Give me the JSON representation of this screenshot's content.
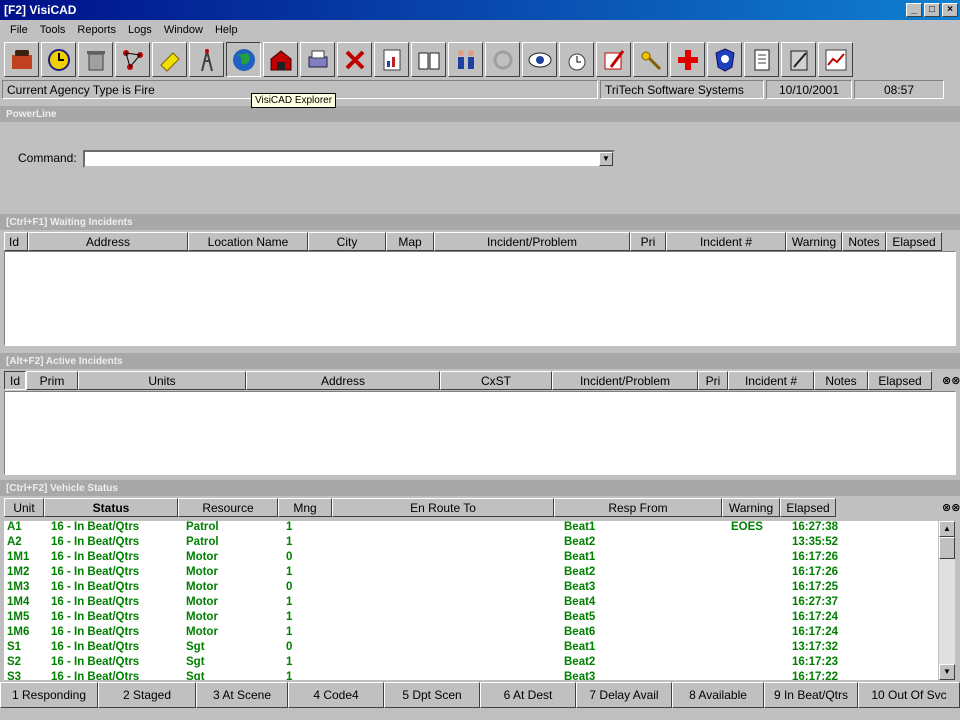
{
  "window": {
    "title": "[F2]   VisiCAD"
  },
  "menu": [
    "File",
    "Tools",
    "Reports",
    "Logs",
    "Window",
    "Help"
  ],
  "toolbar": {
    "icons": [
      "phone-call-icon",
      "clock-icon",
      "trash-can-icon",
      "network-icon",
      "eraser-icon",
      "radio-tower-icon",
      "globe-explorer-icon",
      "fire-station-icon",
      "printer-icon",
      "tools-icon",
      "report-icon",
      "book-icon",
      "people-icon",
      "refresh-icon",
      "eye-icon",
      "alarm-icon",
      "map-pencil-icon",
      "key-icon",
      "red-cross-icon",
      "police-badge-icon",
      "notepad-icon",
      "clipboard-icon",
      "chart-icon"
    ],
    "tooltip": "VisiCAD Explorer"
  },
  "status": {
    "agency": "Current Agency Type is Fire",
    "company": "TriTech Software Systems",
    "date": "10/10/2001",
    "time": "08:57"
  },
  "powerline": {
    "title": "PowerLine",
    "command_label": "Command:",
    "command_value": ""
  },
  "waiting": {
    "title": "[Ctrl+F1]   Waiting Incidents",
    "columns": [
      "Id",
      "Address",
      "Location Name",
      "City",
      "Map",
      "Incident/Problem",
      "Pri",
      "Incident #",
      "Warning",
      "Notes",
      "Elapsed"
    ]
  },
  "active": {
    "title": "[Alt+F2]   Active Incidents",
    "columns": [
      "Id",
      "Prim",
      "Units",
      "Address",
      "CxST",
      "Incident/Problem",
      "Pri",
      "Incident #",
      "Notes",
      "Elapsed"
    ]
  },
  "vehicles": {
    "title": "[Ctrl+F2]   Vehicle Status",
    "columns": [
      "Unit",
      "Status",
      "Resource",
      "Mng",
      "En Route To",
      "Resp From",
      "Warning",
      "Elapsed"
    ],
    "rows": [
      {
        "unit": "A1",
        "status": "16 - In Beat/Qtrs",
        "resource": "Patrol",
        "mng": "1",
        "route": "",
        "resp": "Beat1",
        "warning": "EOES",
        "elapsed": "16:27:38"
      },
      {
        "unit": "A2",
        "status": "16 - In Beat/Qtrs",
        "resource": "Patrol",
        "mng": "1",
        "route": "",
        "resp": "Beat2",
        "warning": "",
        "elapsed": "13:35:52"
      },
      {
        "unit": "1M1",
        "status": "16 - In Beat/Qtrs",
        "resource": "Motor",
        "mng": "0",
        "route": "",
        "resp": "Beat1",
        "warning": "",
        "elapsed": "16:17:26"
      },
      {
        "unit": "1M2",
        "status": "16 - In Beat/Qtrs",
        "resource": "Motor",
        "mng": "1",
        "route": "",
        "resp": "Beat2",
        "warning": "",
        "elapsed": "16:17:26"
      },
      {
        "unit": "1M3",
        "status": "16 - In Beat/Qtrs",
        "resource": "Motor",
        "mng": "0",
        "route": "",
        "resp": "Beat3",
        "warning": "",
        "elapsed": "16:17:25"
      },
      {
        "unit": "1M4",
        "status": "16 - In Beat/Qtrs",
        "resource": "Motor",
        "mng": "1",
        "route": "",
        "resp": "Beat4",
        "warning": "",
        "elapsed": "16:27:37"
      },
      {
        "unit": "1M5",
        "status": "16 - In Beat/Qtrs",
        "resource": "Motor",
        "mng": "1",
        "route": "",
        "resp": "Beat5",
        "warning": "",
        "elapsed": "16:17:24"
      },
      {
        "unit": "1M6",
        "status": "16 - In Beat/Qtrs",
        "resource": "Motor",
        "mng": "1",
        "route": "",
        "resp": "Beat6",
        "warning": "",
        "elapsed": "16:17:24"
      },
      {
        "unit": "S1",
        "status": "16 - In Beat/Qtrs",
        "resource": "Sgt",
        "mng": "0",
        "route": "",
        "resp": "Beat1",
        "warning": "",
        "elapsed": "13:17:32"
      },
      {
        "unit": "S2",
        "status": "16 - In Beat/Qtrs",
        "resource": "Sgt",
        "mng": "1",
        "route": "",
        "resp": "Beat2",
        "warning": "",
        "elapsed": "16:17:23"
      },
      {
        "unit": "S3",
        "status": "16 - In Beat/Qtrs",
        "resource": "Sgt",
        "mng": "1",
        "route": "",
        "resp": "Beat3",
        "warning": "",
        "elapsed": "16:17:22"
      }
    ]
  },
  "bottom_buttons": [
    "1 Responding",
    "2 Staged",
    "3 At Scene",
    "4 Code4",
    "5 Dpt Scen",
    "6 At Dest",
    "7 Delay Avail",
    "8 Available",
    "9 In Beat/Qtrs",
    "10 Out Of Svc"
  ]
}
